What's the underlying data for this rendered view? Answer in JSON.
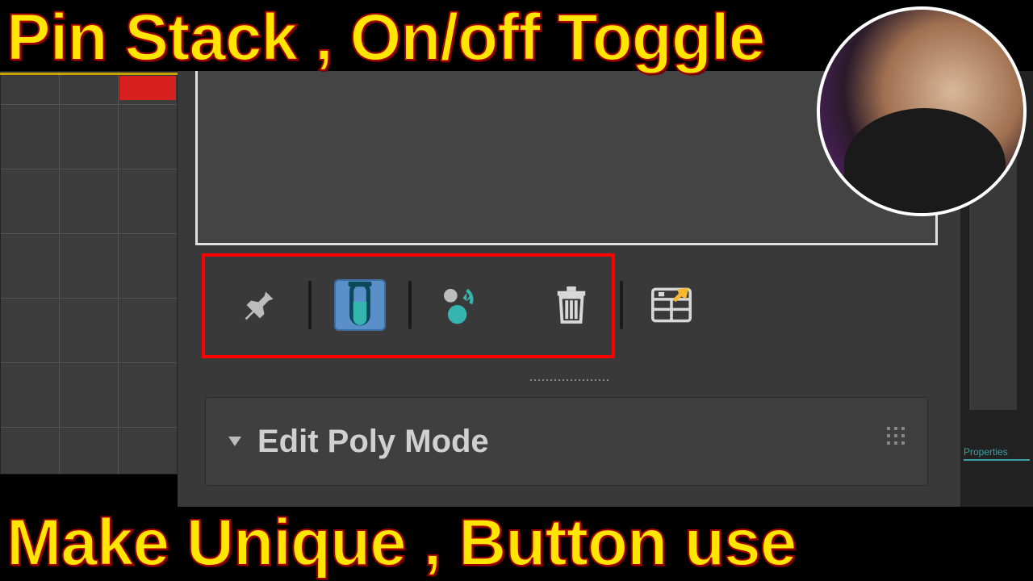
{
  "title_top": "Pin Stack , On/off Toggle",
  "title_bottom": "Make Unique , Button use",
  "rollout": {
    "label": "Edit Poly Mode"
  },
  "sidebar": {
    "properties_tab": "Properties"
  },
  "icons": {
    "pin": "pin-icon",
    "show_end": "test-tube-icon",
    "make_unique": "make-unique-icon",
    "delete": "trash-icon",
    "configure": "configure-sets-icon"
  },
  "colors": {
    "highlight": "#ff0000",
    "active_btn": "#5a8fc7",
    "title_fill": "#ffe600",
    "title_stroke": "#a00000",
    "icon_teal": "#36b5b0"
  }
}
